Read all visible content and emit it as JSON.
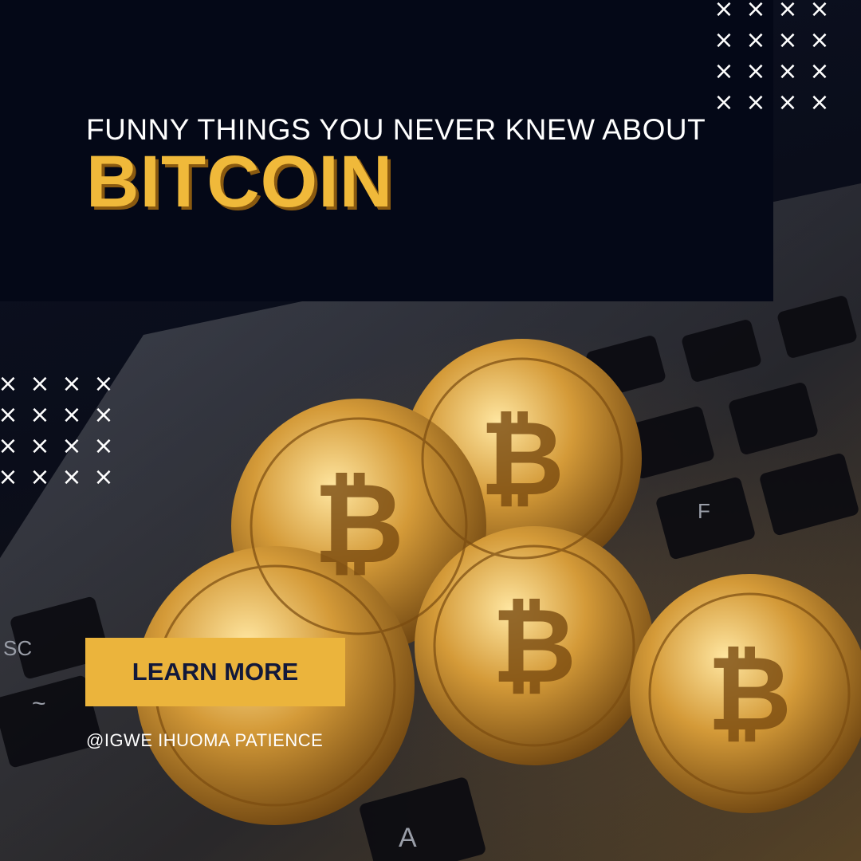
{
  "hero": {
    "subtitle": "FUNNY THINGS YOU NEVER KNEW ABOUT",
    "title": "BITCOIN"
  },
  "cta": {
    "label": "LEARN MORE"
  },
  "credit": {
    "handle": "@IGWE IHUOMA PATIENCE"
  },
  "decor": {
    "pattern_glyph": "×",
    "pattern_rows": 4,
    "pattern_cols": 4
  },
  "keyboard_keys": {
    "esc": "SC",
    "tilde": "~",
    "a": "A",
    "f": "F"
  },
  "colors": {
    "background": "#05091a",
    "accent": "#ebb43c",
    "title_gold": "#f0b93a",
    "text": "#ffffff"
  }
}
